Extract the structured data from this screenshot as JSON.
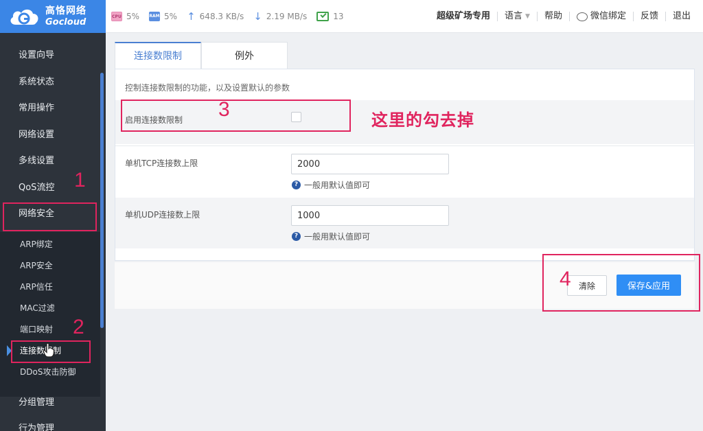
{
  "brand": {
    "name_cn": "高恪网络",
    "name_en": "Gocloud"
  },
  "stats": {
    "cpu_chip": "CPU",
    "cpu": "5%",
    "ram_chip": "RAM",
    "ram": "5%",
    "upload": "648.3 KB/s",
    "download": "2.19 MB/s",
    "devices": "13"
  },
  "topmenu": {
    "edition": "超级矿场专用",
    "language": "语言",
    "help": "帮助",
    "wechat": "微信绑定",
    "feedback": "反馈",
    "logout": "退出"
  },
  "sidebar": {
    "items": [
      "设置向导",
      "系统状态",
      "常用操作",
      "网络设置",
      "多线设置",
      "QoS流控",
      "网络安全"
    ],
    "submenu": [
      "ARP绑定",
      "ARP安全",
      "ARP信任",
      "MAC过滤",
      "端口映射",
      "连接数限制",
      "DDoS攻击防御"
    ],
    "bottom": [
      "分组管理",
      "行为管理"
    ]
  },
  "tabs": [
    "连接数限制",
    "例外"
  ],
  "form": {
    "description": "控制连接数限制的功能，以及设置默认的参数",
    "enable_label": "启用连接数限制",
    "enable_checked": false,
    "tcp_label": "单机TCP连接数上限",
    "tcp_value": "2000",
    "tcp_hint": "一般用默认值即可",
    "udp_label": "单机UDP连接数上限",
    "udp_value": "1000",
    "udp_hint": "一般用默认值即可"
  },
  "buttons": {
    "clear": "清除",
    "save": "保存&应用"
  },
  "annotations": {
    "n1": "1",
    "n2": "2",
    "n3": "3",
    "n4": "4",
    "note": "这里的勾去掉"
  },
  "colors": {
    "brand": "#3b86e6",
    "accent": "#2f8ef5",
    "annotation": "#e0245e",
    "sidebar": "#2d333b"
  }
}
